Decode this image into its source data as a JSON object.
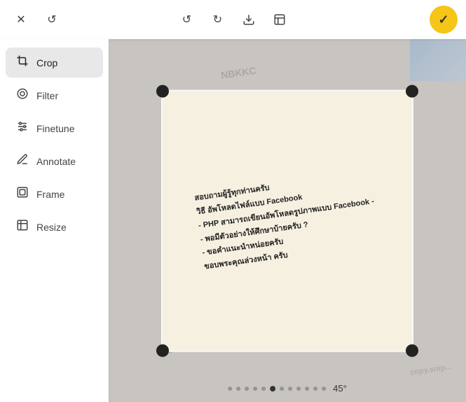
{
  "toolbar": {
    "close_label": "✕",
    "reset_label": "↺",
    "undo_label": "↺",
    "redo_label": "↻",
    "download_label": "⬇",
    "aspect_label": "⛶",
    "confirm_label": "✓"
  },
  "sidebar": {
    "items": [
      {
        "id": "crop",
        "label": "Crop",
        "icon": "⊞",
        "active": true
      },
      {
        "id": "filter",
        "label": "Filter",
        "icon": "◎",
        "active": false
      },
      {
        "id": "finetune",
        "label": "Finetune",
        "icon": "⚙",
        "active": false
      },
      {
        "id": "annotate",
        "label": "Annotate",
        "icon": "✏",
        "active": false
      },
      {
        "id": "frame",
        "label": "Frame",
        "icon": "▢",
        "active": false
      },
      {
        "id": "resize",
        "label": "Resize",
        "icon": "⊡",
        "active": false
      }
    ]
  },
  "canvas": {
    "rotation_label": "45°",
    "doc_lines": [
      "สอบถามผู้รู้ทุกท่านครับ",
      "วิธี อัพโหลดไฟล์แบบ Facebook",
      "- PHP สามารถเขียนอัพโหลดรูปภาพแบบ Facebook -",
      "- พอมีตัวอย่างให้ศึกษาบ้ายครับ ?",
      "- ขอคำแนะนำหน่อยครับ",
      "ขอบพระคุณล่วงหน้า ครับ"
    ]
  },
  "dots": {
    "count": 12,
    "active_index": 5
  }
}
